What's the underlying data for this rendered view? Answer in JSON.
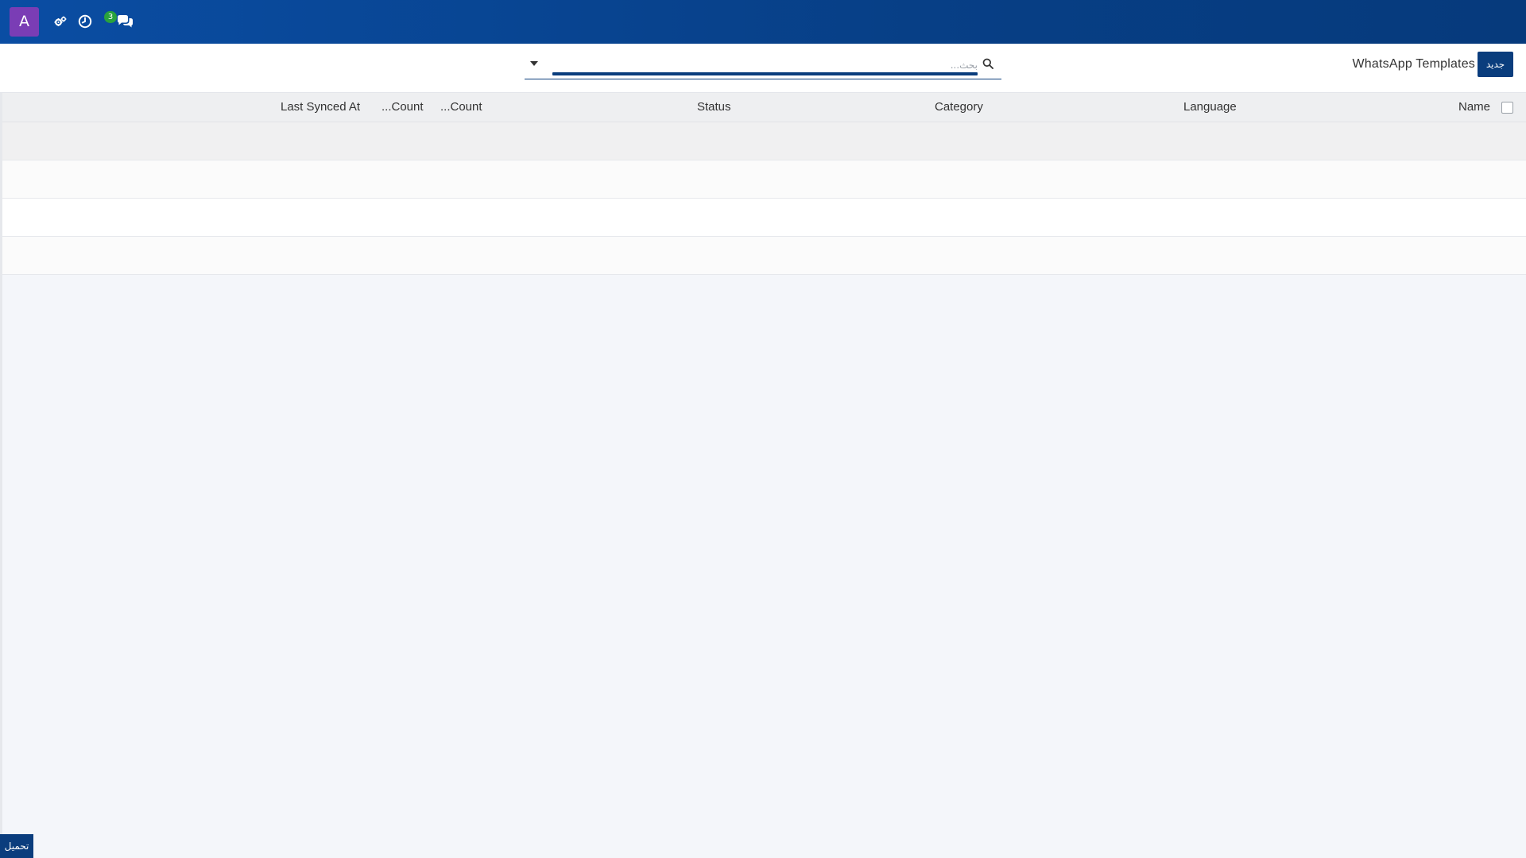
{
  "navbar": {
    "avatar_letter": "A",
    "icons": [
      "settings-cogs-icon",
      "activity-clock-icon",
      "discuss-chat-icon"
    ],
    "message_count": "3",
    "brand_color": "#0a4da3",
    "avatar_color": "#7a3db5",
    "badge_color": "#29a23d"
  },
  "control_panel": {
    "title": "WhatsApp Templates",
    "new_button_label": "جديد",
    "search_placeholder": "بحث..."
  },
  "table": {
    "columns": [
      "Name",
      "Language",
      "Category",
      "Status",
      "...Count",
      "...Count",
      "Last Synced At"
    ],
    "rows": [
      {
        "cells": []
      },
      {
        "cells": []
      },
      {
        "cells": []
      },
      {
        "cells": []
      }
    ]
  },
  "footer": {
    "load_button_label": "تحميل"
  }
}
